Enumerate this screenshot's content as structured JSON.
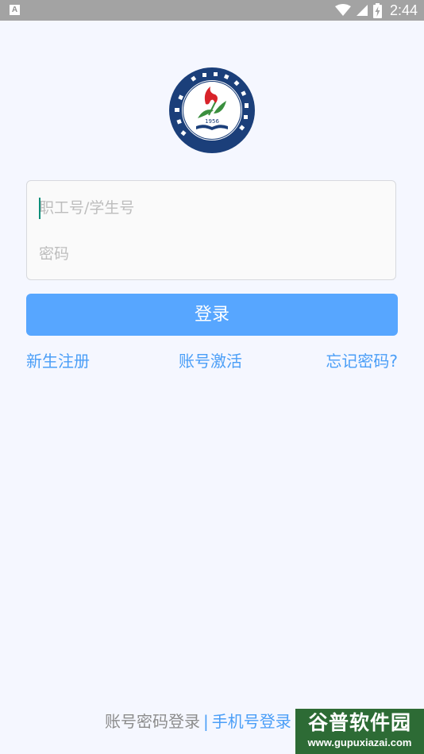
{
  "status_bar": {
    "app_icon_letter": "A",
    "time": "2:44",
    "icons": [
      "wifi-icon",
      "signal-icon",
      "battery-charging-icon"
    ]
  },
  "logo": {
    "year": "1956",
    "name": "university-seal-logo"
  },
  "form": {
    "account_placeholder": "职工号/学生号",
    "account_value": "",
    "password_placeholder": "密码",
    "password_value": ""
  },
  "login_button": {
    "label": "登录"
  },
  "links": {
    "register": "新生注册",
    "activate": "账号激活",
    "forgot": "忘记密码?"
  },
  "login_switch": {
    "password_mode": "账号密码登录",
    "separator": "|",
    "phone_mode": "手机号登录"
  },
  "watermark": {
    "title": "谷普软件园",
    "url": "www.gupuxiazai.com"
  },
  "colors": {
    "background": "#f5f7ff",
    "primary": "#57a6ff",
    "link": "#4a9ef7",
    "status_bar": "#a3a3a3",
    "watermark": "#2d6b35"
  }
}
